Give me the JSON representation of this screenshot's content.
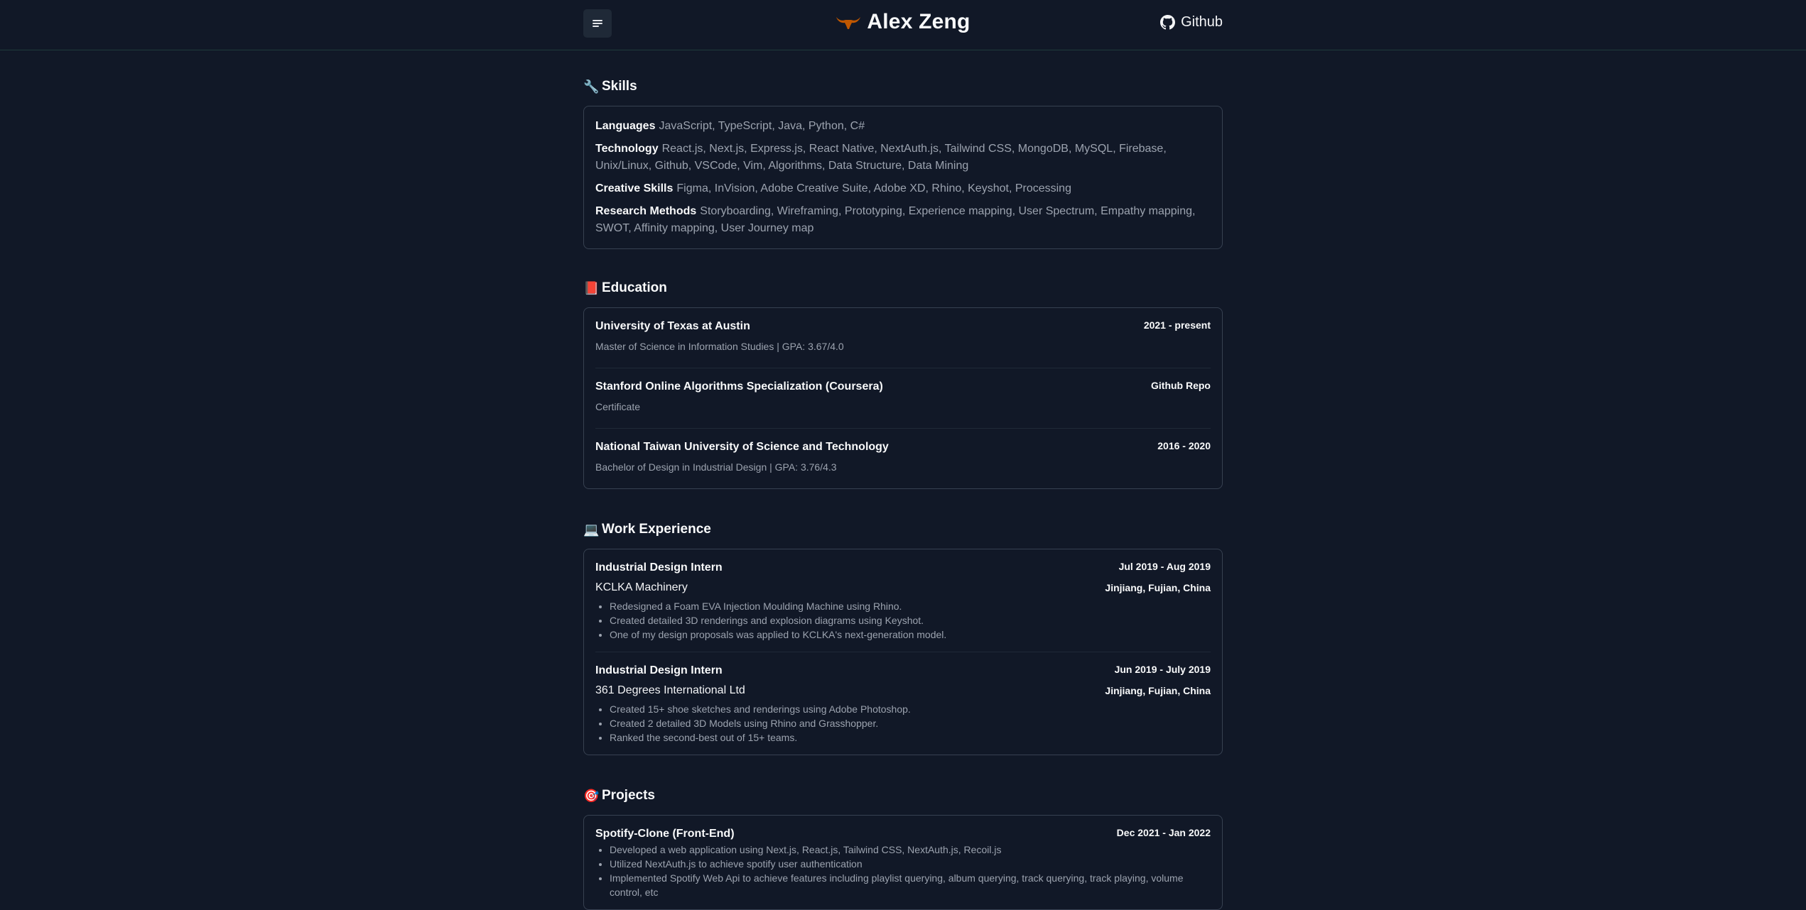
{
  "header": {
    "title": "Alex Zeng",
    "logo_icon": "longhorn-icon",
    "menu_icon": "menu-icon",
    "github_label": "Github",
    "accent": "#bf5700"
  },
  "skills": {
    "emoji": "🔧",
    "title": "Skills",
    "rows": [
      {
        "label": "Languages",
        "value": "JavaScript, TypeScript, Java, Python, C#"
      },
      {
        "label": "Technology",
        "value": "React.js, Next.js, Express.js, React Native, NextAuth.js, Tailwind CSS, MongoDB, MySQL, Firebase, Unix/Linux, Github, VSCode, Vim, Algorithms, Data Structure, Data Mining"
      },
      {
        "label": "Creative Skills",
        "value": "Figma, InVision, Adobe Creative Suite, Adobe XD, Rhino, Keyshot, Processing"
      },
      {
        "label": "Research Methods",
        "value": "Storyboarding, Wireframing, Prototyping, Experience mapping, User Spectrum, Empathy mapping, SWOT, Affinity mapping, User Journey map"
      }
    ]
  },
  "education": {
    "emoji": "📕",
    "title": "Education",
    "entries": [
      {
        "name": "University of Texas at Austin",
        "date": "2021 - present",
        "detail": "Master of Science in Information Studies | GPA: 3.67/4.0"
      },
      {
        "name": "Stanford Online Algorithms Specialization (Coursera)",
        "date": "Github Repo",
        "detail": "Certificate"
      },
      {
        "name": "National Taiwan University of Science and Technology",
        "date": "2016 - 2020",
        "detail": "Bachelor of Design in Industrial Design | GPA: 3.76/4.3"
      }
    ]
  },
  "work": {
    "emoji": "💻",
    "title": "Work Experience",
    "entries": [
      {
        "role": "Industrial Design Intern",
        "date": "Jul 2019 - Aug 2019",
        "company": "KCLKA Machinery",
        "location": "Jinjiang, Fujian, China",
        "bullets": [
          "Redesigned a Foam EVA Injection Moulding Machine using Rhino.",
          "Created detailed 3D renderings and explosion diagrams using Keyshot.",
          "One of my design proposals was applied to KCLKA's next-generation model."
        ]
      },
      {
        "role": "Industrial Design Intern",
        "date": "Jun 2019 - July 2019",
        "company": "361 Degrees International Ltd",
        "location": "Jinjiang, Fujian, China",
        "bullets": [
          "Created 15+ shoe sketches and renderings using Adobe Photoshop.",
          "Created 2 detailed 3D Models using Rhino and Grasshopper.",
          "Ranked the second-best out of 15+ teams."
        ]
      }
    ]
  },
  "projects": {
    "emoji": "🎯",
    "title": "Projects",
    "entries": [
      {
        "name": "Spotify-Clone (Front-End)",
        "date": "Dec 2021 - Jan 2022",
        "bullets": [
          "Developed a web application using Next.js, React.js, Tailwind CSS, NextAuth.js, Recoil.js",
          "Utilized NextAuth.js to achieve spotify user authentication",
          "Implemented Spotify Web Api to achieve features including playlist querying, album querying, track querying, track playing, volume control, etc"
        ]
      }
    ]
  }
}
